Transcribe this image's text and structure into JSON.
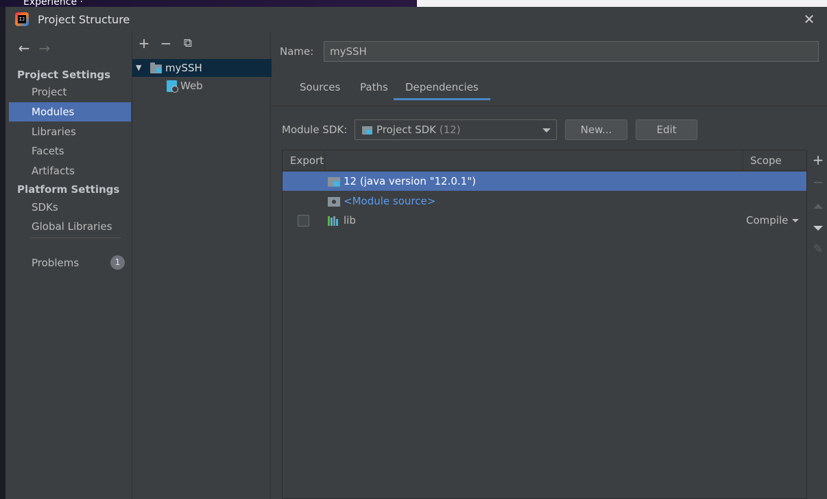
{
  "background": {
    "text": "Experience ·"
  },
  "window": {
    "title": "Project Structure",
    "close_glyph": "✕"
  },
  "sidebar": {
    "back_glyph": "←",
    "forward_glyph": "→",
    "project_settings_header": "Project Settings",
    "platform_settings_header": "Platform Settings",
    "items": [
      {
        "label": "Project",
        "selected": false
      },
      {
        "label": "Modules",
        "selected": true
      },
      {
        "label": "Libraries",
        "selected": false
      },
      {
        "label": "Facets",
        "selected": false
      },
      {
        "label": "Artifacts",
        "selected": false
      }
    ],
    "platform_items": [
      {
        "label": "SDKs"
      },
      {
        "label": "Global Libraries"
      }
    ],
    "problems": {
      "label": "Problems",
      "count": "1"
    }
  },
  "tree": {
    "toolbar": {
      "add": "+",
      "remove": "−",
      "copy": "⧉"
    },
    "nodes": [
      {
        "label": "mySSH",
        "expanded": true,
        "selected": true,
        "icon": "module-folder-icon"
      },
      {
        "label": "Web",
        "icon": "web-facet-icon"
      }
    ]
  },
  "module": {
    "name_label": "Name:",
    "name_value": "mySSH",
    "tabs": [
      {
        "label": "Sources",
        "active": false
      },
      {
        "label": "Paths",
        "active": false
      },
      {
        "label": "Dependencies",
        "active": true
      }
    ],
    "sdk_label": "Module SDK:",
    "sdk_value": "Project SDK",
    "sdk_version": "(12)",
    "new_button": "New...",
    "edit_button": "Edit"
  },
  "dependencies": {
    "columns": {
      "export": "Export",
      "scope": "Scope"
    },
    "rows": [
      {
        "label": "12 (java version \"12.0.1\")",
        "icon": "jdk-icon",
        "selected": true,
        "has_checkbox": false,
        "scope": ""
      },
      {
        "label": "<Module source>",
        "icon": "module-source-icon",
        "selected": false,
        "has_checkbox": false,
        "scope": ""
      },
      {
        "label": "lib",
        "icon": "library-icon",
        "selected": false,
        "has_checkbox": true,
        "checked": false,
        "scope": "Compile"
      }
    ],
    "tools": {
      "add": "+",
      "remove": "−",
      "edit": "✎"
    }
  },
  "colors": {
    "dialog_bg": "#3c3f41",
    "selection": "#4b6eaf",
    "tree_selection": "#0d293e",
    "tab_underline": "#4a88c7",
    "link": "#589df6",
    "icon_blue": "#40b6e0"
  }
}
